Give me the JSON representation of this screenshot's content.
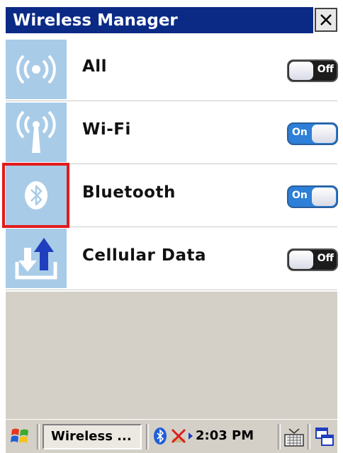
{
  "window": {
    "title": "Wireless Manager",
    "close_label": "×"
  },
  "rows": [
    {
      "label": "All",
      "state": "Off",
      "icon": "broadcast-icon"
    },
    {
      "label": "Wi-Fi",
      "state": "On",
      "icon": "wifi-antenna-icon"
    },
    {
      "label": "Bluetooth",
      "state": "On",
      "icon": "bluetooth-icon"
    },
    {
      "label": "Cellular Data",
      "state": "Off",
      "icon": "cellular-data-icon"
    }
  ],
  "taskbar": {
    "task_label": "Wireless ...",
    "clock": "2:03 PM"
  },
  "colors": {
    "title_bar": "#0a2a86",
    "icon_tile": "#a8cbe8",
    "toggle_on": "#2d7fd7",
    "toggle_off": "#1c1c1c",
    "highlight": "#e31b1b",
    "taskbar": "#d4d0c8"
  }
}
